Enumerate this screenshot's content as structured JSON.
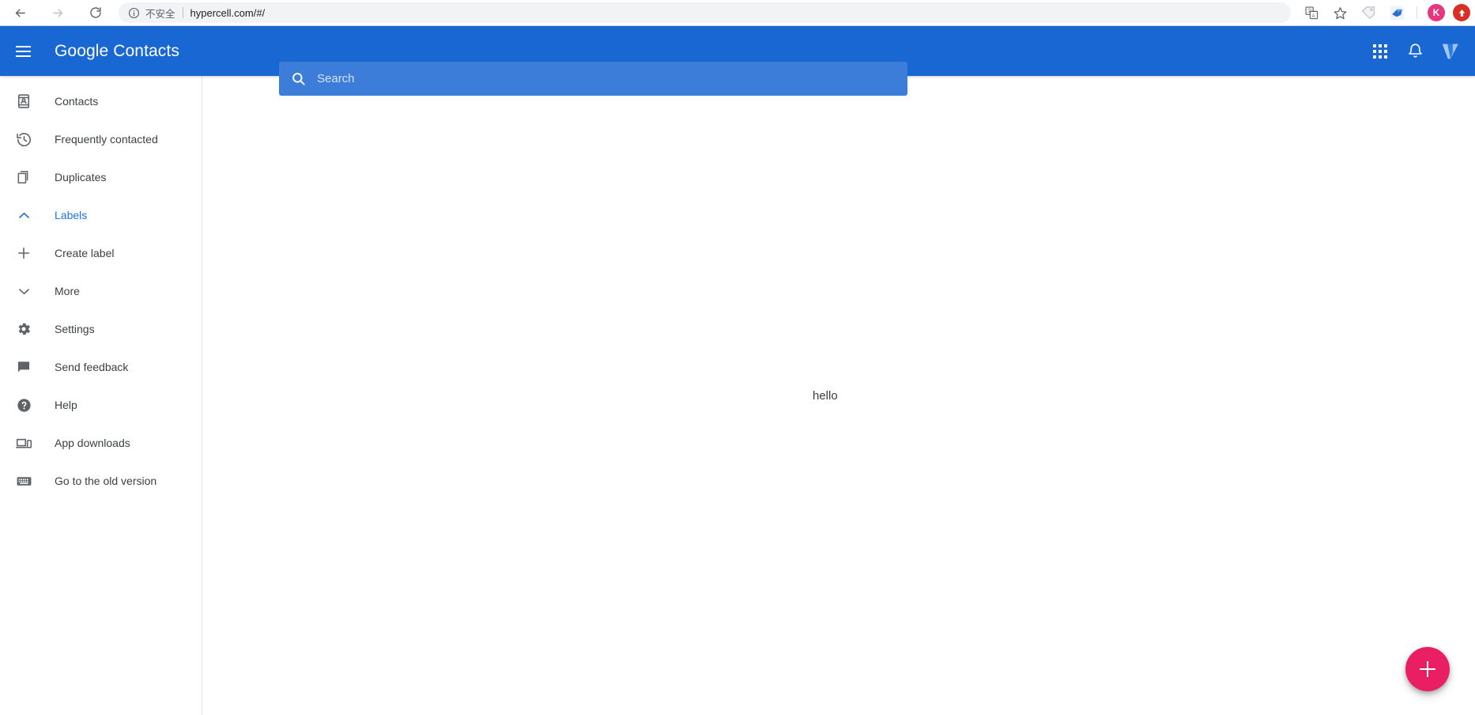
{
  "browser": {
    "back_icon": "arrow-left-icon",
    "forward_icon": "arrow-right-icon",
    "reload_icon": "reload-icon",
    "info_icon": "info-circle-icon",
    "security_label": "不安全",
    "url": "hypercell.com/#/",
    "translate_icon": "translate-icon",
    "bookmark_icon": "star-outline-icon",
    "tag_extension_icon": "tag-icon",
    "bird_extension_icon": "bird-icon",
    "profile_initial": "K",
    "update_icon": "update-arrow-icon"
  },
  "header": {
    "menu_icon": "hamburger-menu-icon",
    "title": "Google Contacts",
    "search": {
      "icon": "search-icon",
      "placeholder": "Search",
      "value": ""
    },
    "apps_icon": "apps-grid-icon",
    "notifications_icon": "bell-icon",
    "account_logo": "v-logo-avatar"
  },
  "sidebar": {
    "items": [
      {
        "label": "Contacts",
        "icon": "contact-card-icon",
        "active": false
      },
      {
        "label": "Frequently contacted",
        "icon": "history-clock-icon",
        "active": false
      },
      {
        "label": "Duplicates",
        "icon": "copy-pages-icon",
        "active": false
      },
      {
        "label": "Labels",
        "icon": "chevron-up-icon",
        "active": true
      },
      {
        "label": "Create label",
        "icon": "plus-icon",
        "active": false
      },
      {
        "label": "More",
        "icon": "chevron-down-icon",
        "active": false
      },
      {
        "label": "Settings",
        "icon": "gear-icon",
        "active": false
      },
      {
        "label": "Send feedback",
        "icon": "speech-bubble-icon",
        "active": false
      },
      {
        "label": "Help",
        "icon": "help-circle-icon",
        "active": false
      },
      {
        "label": "App downloads",
        "icon": "devices-icon",
        "active": false
      },
      {
        "label": "Go to the old version",
        "icon": "keyboard-icon",
        "active": false
      }
    ]
  },
  "main": {
    "content_text": "hello"
  },
  "fab": {
    "icon": "plus-icon",
    "label": ""
  },
  "colors": {
    "header_blue": "#1967d2",
    "search_blue": "#3b7dd8",
    "accent_blue": "#1a73e8",
    "fab_pink": "#e91e63",
    "text_primary": "#3c4043"
  }
}
